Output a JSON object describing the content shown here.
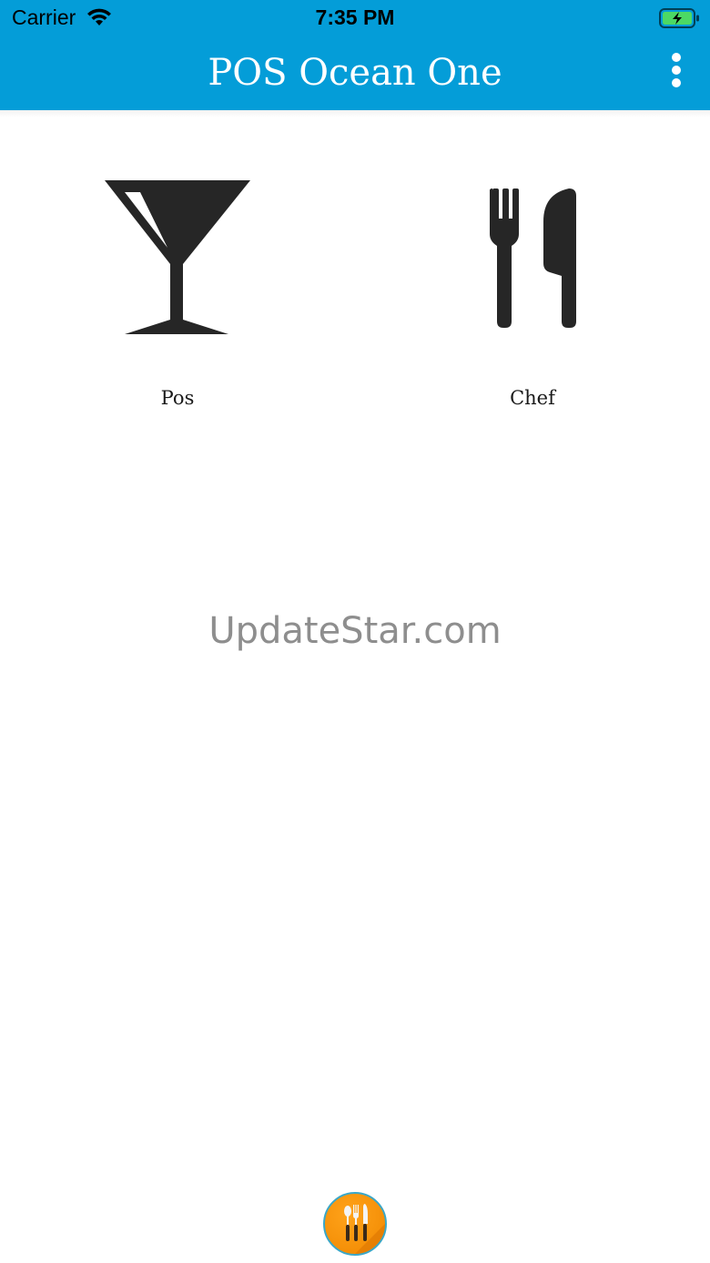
{
  "status_bar": {
    "carrier": "Carrier",
    "time": "7:35 PM"
  },
  "app_bar": {
    "title": "POS Ocean One",
    "menu_icon": "more-vertical-icon"
  },
  "tiles": [
    {
      "label": "Pos",
      "icon": "cocktail-glass-icon"
    },
    {
      "label": "Chef",
      "icon": "fork-knife-icon"
    }
  ],
  "watermark": "UpdateStar.com",
  "fab": {
    "icon": "utensils-icon"
  },
  "colors": {
    "app_bar": "#049dd8",
    "icon_dark": "#262626",
    "fab_orange": "#f08700"
  }
}
